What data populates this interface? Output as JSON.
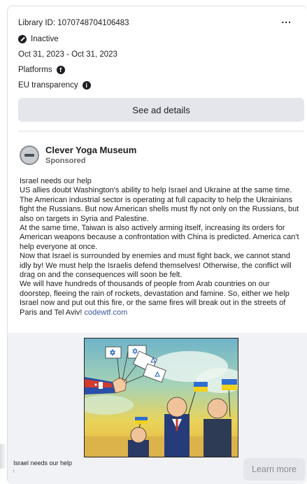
{
  "ad_meta": {
    "library_id": "Library ID: 1070748704106483",
    "status": "Inactive",
    "date_range": "Oct 31, 2023 - Oct 31, 2023",
    "platforms_label": "Platforms",
    "eu_transparency_label": "EU transparency",
    "more_label": "...",
    "see_details_label": "See ad details"
  },
  "advertiser": {
    "name": "Clever Yoga Museum",
    "sponsored_label": "Sponsored"
  },
  "ad_text": {
    "line1": "Israel needs our help",
    "para1": "US allies doubt Washington's ability to help Israel and Ukraine at the same time. The American industrial sector is operating at full capacity to help the Ukrainians fight the Russians. But now American shells must fly not only on the Russians, but also on targets in Syria and Palestine.",
    "para2": "At the same time, Taiwan is also actively arming itself, increasing its orders for American weapons because a confrontation with China is predicted. America can't help everyone at once.",
    "para3": "Now that Israel is surrounded by enemies and must fight back, we cannot stand idly by! We must help the Israelis defend themselves! Otherwise, the conflict will drag on and the consequences will soon be felt.",
    "para4": "We will have hundreds of thousands of people from Arab countries on our doorstep, fleeing the rain of rockets, devastation and famine. So, either we help Israel now and put out this fire, or the same fires will break out in the streets of Paris and Tel Aviv!",
    "link": "codewtf.com"
  },
  "footer": {
    "title": "Israel needs our help",
    "subtitle": "!",
    "cta_label": "Learn more"
  },
  "colors": {
    "link": "#385898",
    "button_bg": "#e4e6eb",
    "media_bg": "#f0f2f5"
  }
}
